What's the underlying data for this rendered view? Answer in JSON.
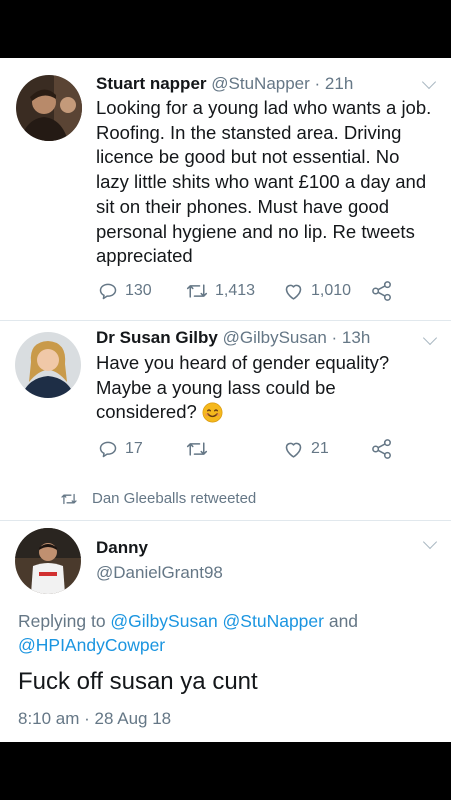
{
  "tweets": [
    {
      "name": "Stuart napper",
      "handle": "@StuNapper",
      "time": "· 21h",
      "lines": [
        "Looking for a young lad who wants a job.",
        "Roofing. In the  stansted area. Driving",
        "licence be good but not essential. No",
        "lazy little shits who want £100 a day and",
        "sit on their phones. Must have good",
        "personal hygiene and no lip. Re tweets",
        "appreciated"
      ],
      "replies": "130",
      "retweets": "1,413",
      "likes": "1,010"
    },
    {
      "name": "Dr Susan Gilby",
      "handle": "@GilbySusan",
      "time": "· 13h",
      "lines": [
        "Have you heard of gender equality?",
        "Maybe a young lass could be",
        "considered?"
      ],
      "emoji": "smiling-face",
      "replies": "17",
      "retweets": "",
      "likes": "21"
    }
  ],
  "retweet_banner": "Dan Gleeballs retweeted",
  "reply": {
    "name": "Danny",
    "handle": "@DanielGrant98",
    "replying_prefix": "Replying to ",
    "replying_handles": "@GilbySusan @StuNapper",
    "replying_and": " and",
    "replying_handle_2": "@HPIAndyCowper",
    "text": "Fuck off susan ya cunt",
    "timestamp": "8:10 am · 28 Aug 18"
  },
  "colors": {
    "link": "#1b95e0",
    "muted": "#657786",
    "text": "#14171a",
    "emoji": "#f5b81c"
  }
}
